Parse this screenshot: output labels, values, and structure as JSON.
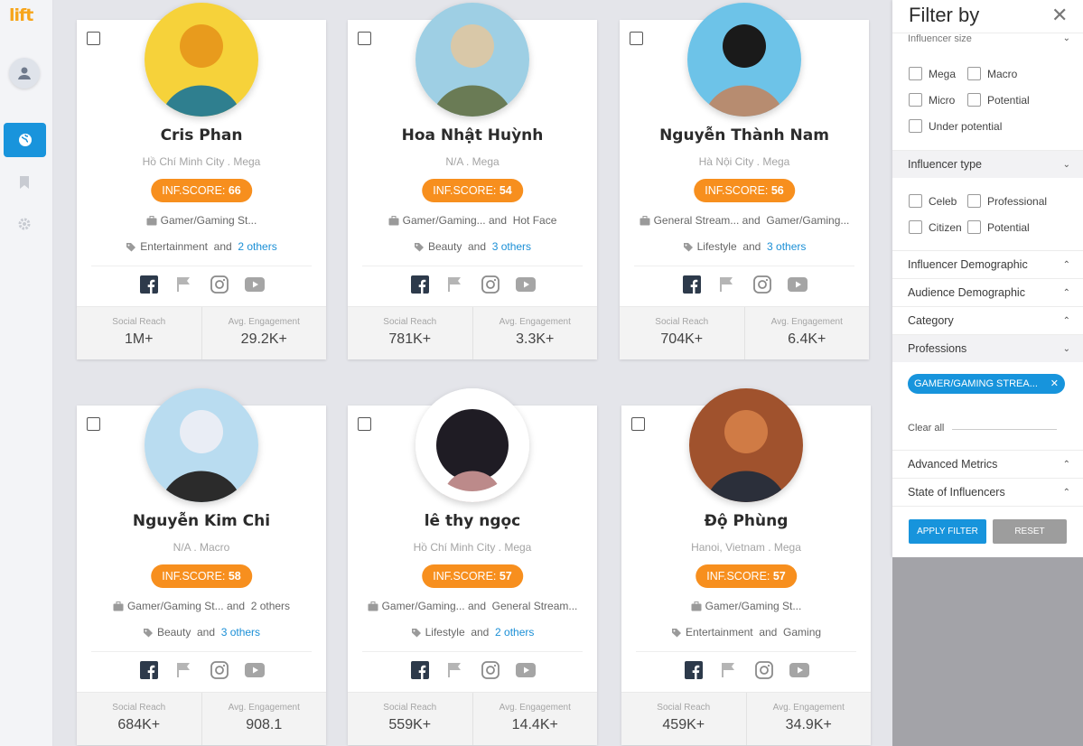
{
  "app": {
    "logo": "lift"
  },
  "cards": [
    {
      "name": "Cris Phan",
      "location": "Hồ Chí Minh City . Mega",
      "score_label": "INF.SCORE: ",
      "score": "66",
      "profession": "Gamer/Gaming St...",
      "profession_and": "",
      "profession_more": "",
      "category": "Entertainment",
      "category_and": "and",
      "category_more": "2 others",
      "reach_label": "Social Reach",
      "reach": "1M+",
      "engagement_label": "Avg. Engagement",
      "engagement": "29.2K+"
    },
    {
      "name": "Hoa Nhật Huỳnh",
      "location": "N/A . Mega",
      "score_label": "INF.SCORE: ",
      "score": "54",
      "profession": "Gamer/Gaming...",
      "profession_and": "and",
      "profession_more": "Hot Face",
      "category": "Beauty",
      "category_and": "and",
      "category_more": "3 others",
      "reach_label": "Social Reach",
      "reach": "781K+",
      "engagement_label": "Avg. Engagement",
      "engagement": "3.3K+"
    },
    {
      "name": "Nguyễn Thành Nam",
      "location": "Hà Nội City . Mega",
      "score_label": "INF.SCORE: ",
      "score": "56",
      "profession": "General Stream...",
      "profession_and": "and",
      "profession_more": "Gamer/Gaming...",
      "category": "Lifestyle",
      "category_and": "and",
      "category_more": "3 others",
      "reach_label": "Social Reach",
      "reach": "704K+",
      "engagement_label": "Avg. Engagement",
      "engagement": "6.4K+"
    },
    {
      "name": "Nguyễn Kim Chi",
      "location": "N/A . Macro",
      "score_label": "INF.SCORE: ",
      "score": "58",
      "profession": "Gamer/Gaming St...",
      "profession_and": "and",
      "profession_more": "2 others",
      "category": "Beauty",
      "category_and": "and",
      "category_more": "3 others",
      "reach_label": "Social Reach",
      "reach": "684K+",
      "engagement_label": "Avg. Engagement",
      "engagement": "908.1"
    },
    {
      "name": "lê thy ngọc",
      "location": "Hồ Chí Minh City . Mega",
      "score_label": "INF.SCORE: ",
      "score": "57",
      "profession": "Gamer/Gaming...",
      "profession_and": "and",
      "profession_more": "General Stream...",
      "category": "Lifestyle",
      "category_and": "and",
      "category_more": "2 others",
      "reach_label": "Social Reach",
      "reach": "559K+",
      "engagement_label": "Avg. Engagement",
      "engagement": "14.4K+"
    },
    {
      "name": "Độ Phùng",
      "location": "Hanoi, Vietnam . Mega",
      "score_label": "INF.SCORE: ",
      "score": "57",
      "profession": "Gamer/Gaming St...",
      "profession_and": "",
      "profession_more": "",
      "category": "Entertainment",
      "category_and": "and",
      "category_more": "Gaming",
      "reach_label": "Social Reach",
      "reach": "459K+",
      "engagement_label": "Avg. Engagement",
      "engagement": "34.9K+"
    }
  ],
  "filter": {
    "title": "Filter by",
    "size_section": "Influencer size",
    "size_options": [
      "Mega",
      "Macro",
      "Micro",
      "Potential",
      "Under potential"
    ],
    "type_section": "Influencer type",
    "type_options": [
      "Celeb",
      "Professional",
      "Citizen",
      "Potential"
    ],
    "sections": [
      "Influencer Demographic",
      "Audience Demographic",
      "Category",
      "Professions"
    ],
    "chip": "GAMER/GAMING STREA...",
    "clear_all": "Clear all",
    "lower_sections": [
      "Advanced Metrics",
      "State of Influencers"
    ],
    "apply": "APPLY FILTER",
    "reset": "RESET"
  },
  "colors": {
    "accent": "#1794dc",
    "score": "#f78f1e",
    "logo": "#f7a51b"
  }
}
